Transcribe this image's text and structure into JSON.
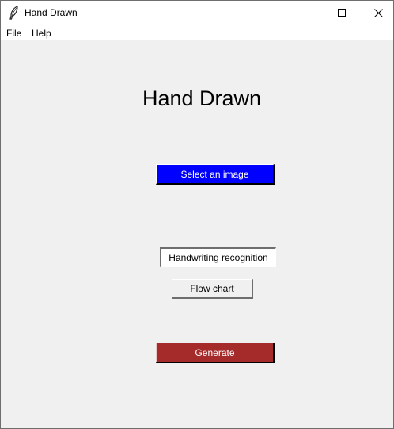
{
  "window": {
    "title": "Hand Drawn",
    "controls": {
      "minimize_icon": "minimize-icon",
      "maximize_icon": "maximize-icon",
      "close_icon": "close-icon"
    }
  },
  "menubar": {
    "items": [
      {
        "label": "File"
      },
      {
        "label": "Help"
      }
    ]
  },
  "main": {
    "heading": "Hand Drawn",
    "select_image_label": "Select an image",
    "mode_options": [
      {
        "label": "Handwriting recognition",
        "selected": true
      },
      {
        "label": "Flow chart",
        "selected": false
      }
    ],
    "generate_label": "Generate"
  },
  "colors": {
    "select_button_bg": "#0000ff",
    "generate_button_bg": "#a52a2a",
    "window_bg": "#f0f0f0"
  }
}
